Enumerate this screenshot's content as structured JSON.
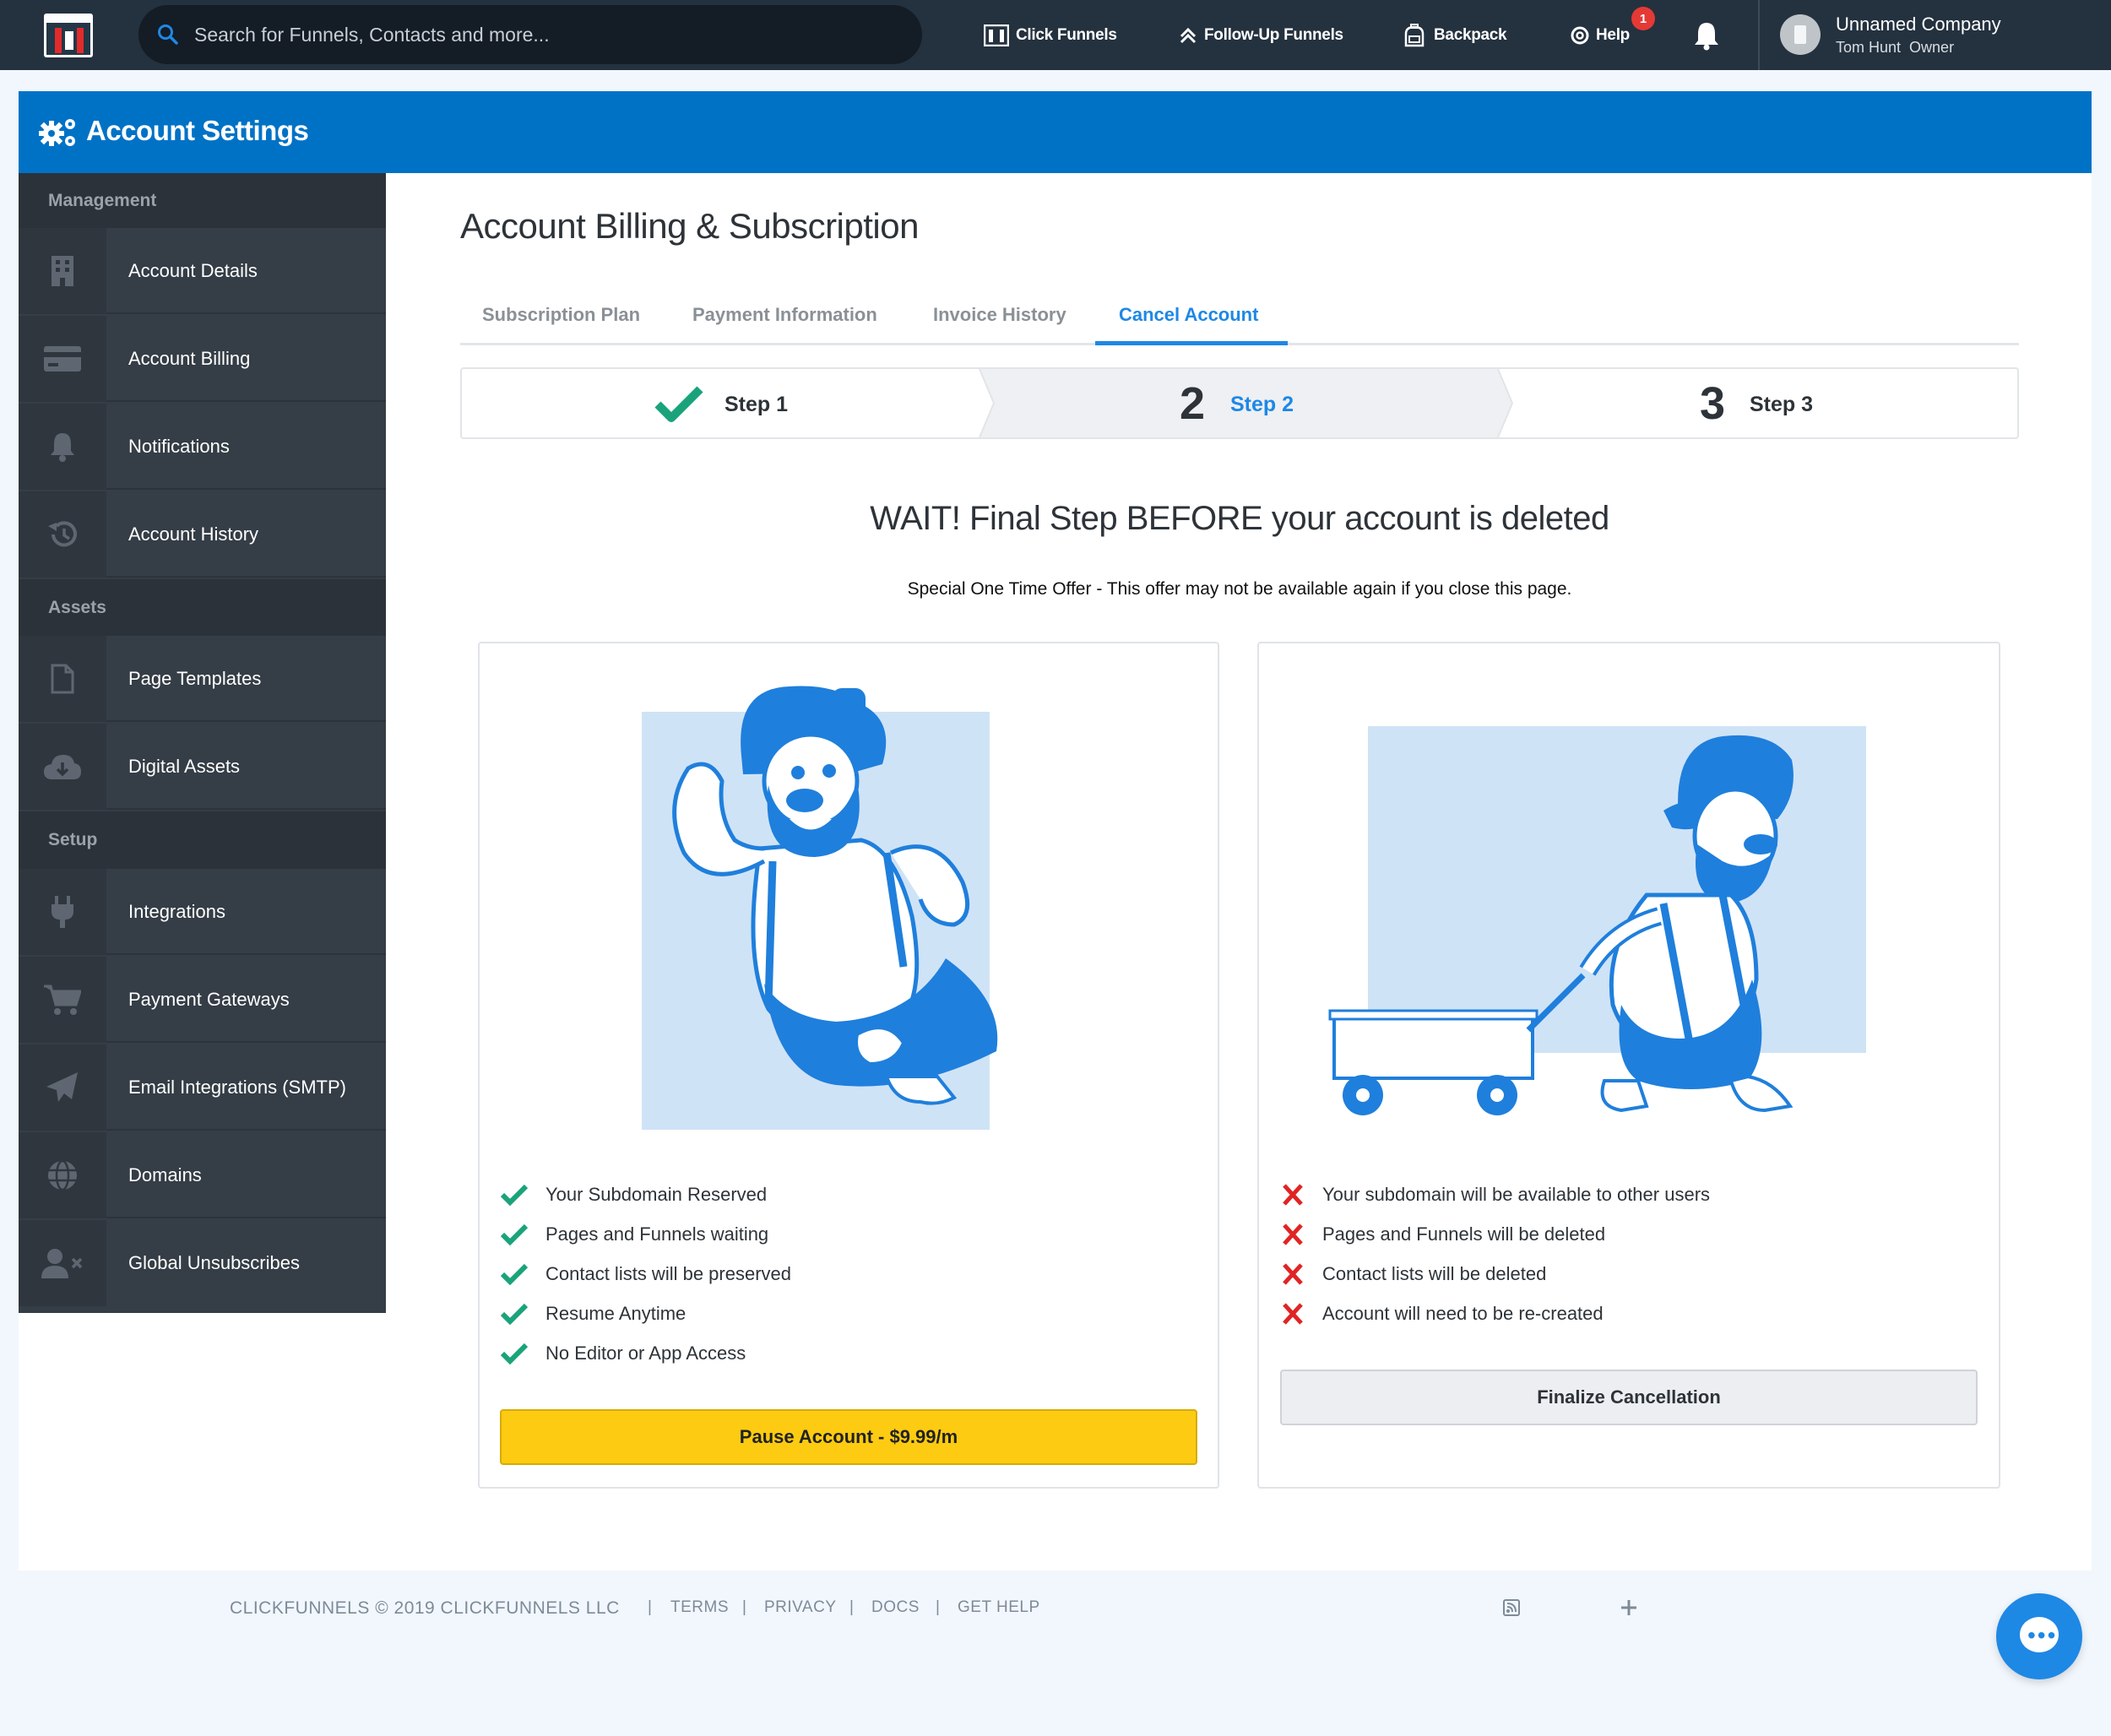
{
  "nav": {
    "search_placeholder": "Search for Funnels, Contacts and more...",
    "items": [
      "Click Funnels",
      "Follow-Up Funnels",
      "Backpack",
      "Help"
    ],
    "help_badge": "1",
    "company": "Unnamed Company",
    "user": "Tom Hunt",
    "role": "Owner"
  },
  "header": {
    "title": "Account Settings"
  },
  "sidebar": {
    "sections": [
      "Management",
      "Assets",
      "Setup"
    ],
    "items": [
      {
        "label": "Account Details",
        "icon": "building-icon"
      },
      {
        "label": "Account Billing",
        "icon": "credit-card-icon"
      },
      {
        "label": "Notifications",
        "icon": "bell-icon"
      },
      {
        "label": "Account History",
        "icon": "history-icon"
      },
      {
        "label": "Page Templates",
        "icon": "file-icon"
      },
      {
        "label": "Digital Assets",
        "icon": "cloud-download-icon"
      },
      {
        "label": "Integrations",
        "icon": "plug-icon"
      },
      {
        "label": "Payment Gateways",
        "icon": "cart-icon"
      },
      {
        "label": "Email Integrations (SMTP)",
        "icon": "paper-plane-icon"
      },
      {
        "label": "Domains",
        "icon": "globe-icon"
      },
      {
        "label": "Global Unsubscribes",
        "icon": "user-times-icon"
      }
    ]
  },
  "main": {
    "title": "Account Billing & Subscription",
    "tabs": [
      "Subscription Plan",
      "Payment Information",
      "Invoice History",
      "Cancel Account"
    ],
    "active_tab": "Cancel Account",
    "steps": [
      {
        "num": "",
        "label": "Step 1"
      },
      {
        "num": "2",
        "label": "Step 2"
      },
      {
        "num": "3",
        "label": "Step 3"
      }
    ],
    "headline": "WAIT! Final Step BEFORE your account is deleted",
    "subtext": "Special One Time Offer - This offer may not be available again if you close this page.",
    "pause_card": {
      "benefits": [
        "Your Subdomain Reserved",
        "Pages and Funnels waiting",
        "Contact lists will be preserved",
        "Resume Anytime",
        "No Editor or App Access"
      ],
      "button": "Pause Account - $9.99/m"
    },
    "cancel_card": {
      "consequences": [
        "Your subdomain will be available to other users",
        "Pages and Funnels will be deleted",
        "Contact lists will be deleted",
        "Account will need to be re-created"
      ],
      "button": "Finalize Cancellation"
    }
  },
  "footer": {
    "copyright": "CLICKFUNNELS © 2019 CLICKFUNNELS LLC",
    "links": [
      "TERMS",
      "PRIVACY",
      "DOCS",
      "GET HELP"
    ]
  },
  "colors": {
    "nav_bg": "#24313f",
    "brand_blue": "#0072c6",
    "accent": "#1e88e5",
    "pause_yellow": "#fdcb12",
    "check_green": "#1aa37a",
    "cross_red": "#e02424"
  }
}
